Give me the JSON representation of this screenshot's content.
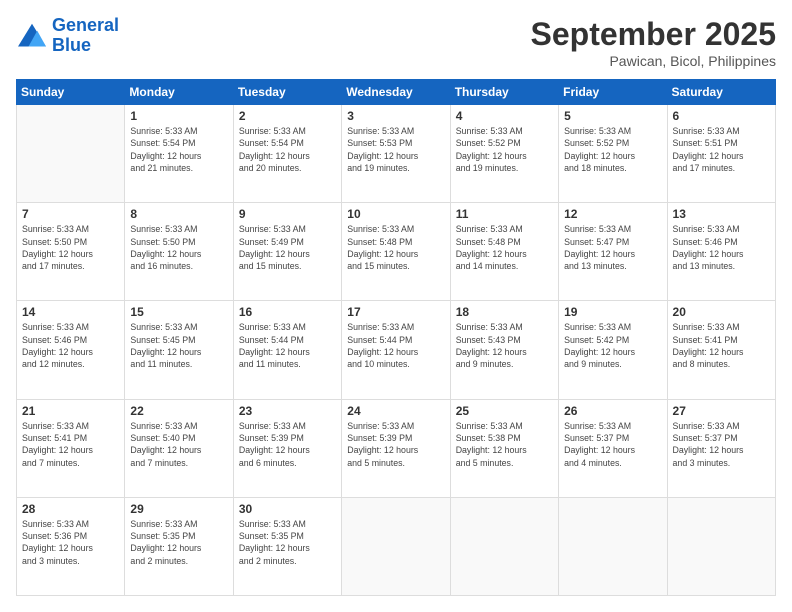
{
  "logo": {
    "line1": "General",
    "line2": "Blue"
  },
  "header": {
    "month": "September 2025",
    "location": "Pawican, Bicol, Philippines"
  },
  "weekdays": [
    "Sunday",
    "Monday",
    "Tuesday",
    "Wednesday",
    "Thursday",
    "Friday",
    "Saturday"
  ],
  "weeks": [
    [
      {
        "day": "",
        "info": ""
      },
      {
        "day": "1",
        "info": "Sunrise: 5:33 AM\nSunset: 5:54 PM\nDaylight: 12 hours\nand 21 minutes."
      },
      {
        "day": "2",
        "info": "Sunrise: 5:33 AM\nSunset: 5:54 PM\nDaylight: 12 hours\nand 20 minutes."
      },
      {
        "day": "3",
        "info": "Sunrise: 5:33 AM\nSunset: 5:53 PM\nDaylight: 12 hours\nand 19 minutes."
      },
      {
        "day": "4",
        "info": "Sunrise: 5:33 AM\nSunset: 5:52 PM\nDaylight: 12 hours\nand 19 minutes."
      },
      {
        "day": "5",
        "info": "Sunrise: 5:33 AM\nSunset: 5:52 PM\nDaylight: 12 hours\nand 18 minutes."
      },
      {
        "day": "6",
        "info": "Sunrise: 5:33 AM\nSunset: 5:51 PM\nDaylight: 12 hours\nand 17 minutes."
      }
    ],
    [
      {
        "day": "7",
        "info": "Sunrise: 5:33 AM\nSunset: 5:50 PM\nDaylight: 12 hours\nand 17 minutes."
      },
      {
        "day": "8",
        "info": "Sunrise: 5:33 AM\nSunset: 5:50 PM\nDaylight: 12 hours\nand 16 minutes."
      },
      {
        "day": "9",
        "info": "Sunrise: 5:33 AM\nSunset: 5:49 PM\nDaylight: 12 hours\nand 15 minutes."
      },
      {
        "day": "10",
        "info": "Sunrise: 5:33 AM\nSunset: 5:48 PM\nDaylight: 12 hours\nand 15 minutes."
      },
      {
        "day": "11",
        "info": "Sunrise: 5:33 AM\nSunset: 5:48 PM\nDaylight: 12 hours\nand 14 minutes."
      },
      {
        "day": "12",
        "info": "Sunrise: 5:33 AM\nSunset: 5:47 PM\nDaylight: 12 hours\nand 13 minutes."
      },
      {
        "day": "13",
        "info": "Sunrise: 5:33 AM\nSunset: 5:46 PM\nDaylight: 12 hours\nand 13 minutes."
      }
    ],
    [
      {
        "day": "14",
        "info": "Sunrise: 5:33 AM\nSunset: 5:46 PM\nDaylight: 12 hours\nand 12 minutes."
      },
      {
        "day": "15",
        "info": "Sunrise: 5:33 AM\nSunset: 5:45 PM\nDaylight: 12 hours\nand 11 minutes."
      },
      {
        "day": "16",
        "info": "Sunrise: 5:33 AM\nSunset: 5:44 PM\nDaylight: 12 hours\nand 11 minutes."
      },
      {
        "day": "17",
        "info": "Sunrise: 5:33 AM\nSunset: 5:44 PM\nDaylight: 12 hours\nand 10 minutes."
      },
      {
        "day": "18",
        "info": "Sunrise: 5:33 AM\nSunset: 5:43 PM\nDaylight: 12 hours\nand 9 minutes."
      },
      {
        "day": "19",
        "info": "Sunrise: 5:33 AM\nSunset: 5:42 PM\nDaylight: 12 hours\nand 9 minutes."
      },
      {
        "day": "20",
        "info": "Sunrise: 5:33 AM\nSunset: 5:41 PM\nDaylight: 12 hours\nand 8 minutes."
      }
    ],
    [
      {
        "day": "21",
        "info": "Sunrise: 5:33 AM\nSunset: 5:41 PM\nDaylight: 12 hours\nand 7 minutes."
      },
      {
        "day": "22",
        "info": "Sunrise: 5:33 AM\nSunset: 5:40 PM\nDaylight: 12 hours\nand 7 minutes."
      },
      {
        "day": "23",
        "info": "Sunrise: 5:33 AM\nSunset: 5:39 PM\nDaylight: 12 hours\nand 6 minutes."
      },
      {
        "day": "24",
        "info": "Sunrise: 5:33 AM\nSunset: 5:39 PM\nDaylight: 12 hours\nand 5 minutes."
      },
      {
        "day": "25",
        "info": "Sunrise: 5:33 AM\nSunset: 5:38 PM\nDaylight: 12 hours\nand 5 minutes."
      },
      {
        "day": "26",
        "info": "Sunrise: 5:33 AM\nSunset: 5:37 PM\nDaylight: 12 hours\nand 4 minutes."
      },
      {
        "day": "27",
        "info": "Sunrise: 5:33 AM\nSunset: 5:37 PM\nDaylight: 12 hours\nand 3 minutes."
      }
    ],
    [
      {
        "day": "28",
        "info": "Sunrise: 5:33 AM\nSunset: 5:36 PM\nDaylight: 12 hours\nand 3 minutes."
      },
      {
        "day": "29",
        "info": "Sunrise: 5:33 AM\nSunset: 5:35 PM\nDaylight: 12 hours\nand 2 minutes."
      },
      {
        "day": "30",
        "info": "Sunrise: 5:33 AM\nSunset: 5:35 PM\nDaylight: 12 hours\nand 2 minutes."
      },
      {
        "day": "",
        "info": ""
      },
      {
        "day": "",
        "info": ""
      },
      {
        "day": "",
        "info": ""
      },
      {
        "day": "",
        "info": ""
      }
    ]
  ]
}
